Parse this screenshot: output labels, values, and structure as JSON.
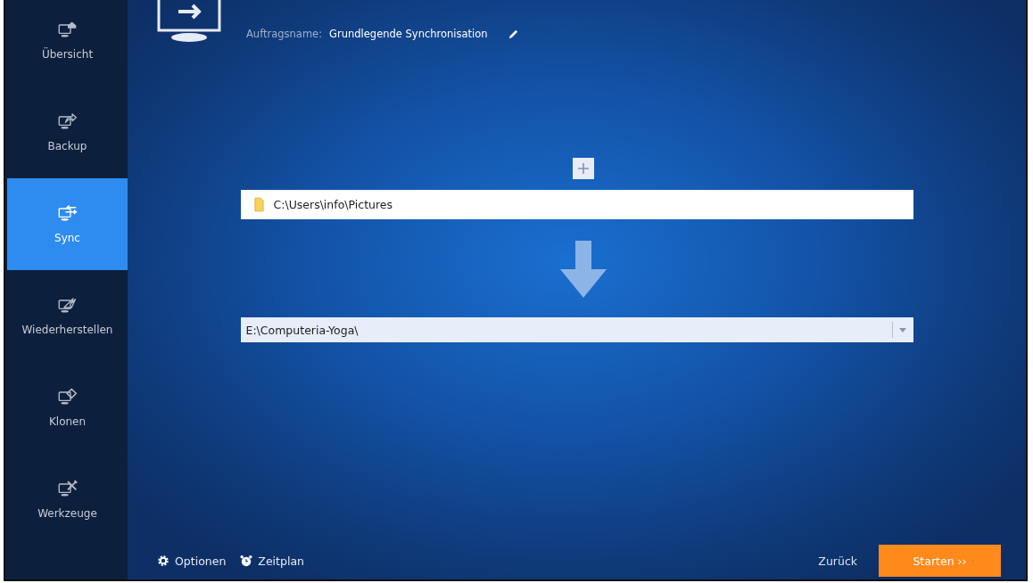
{
  "sidebar": {
    "items": [
      {
        "label": "Übersicht",
        "selected": false
      },
      {
        "label": "Backup",
        "selected": false
      },
      {
        "label": "Sync",
        "selected": true
      },
      {
        "label": "Wiederherstellen",
        "selected": false
      },
      {
        "label": "Klonen",
        "selected": false
      },
      {
        "label": "Werkzeuge",
        "selected": false
      }
    ]
  },
  "job": {
    "name_label": "Auftragsname:",
    "name": "Grundlegende Synchronisation"
  },
  "source": {
    "path": "C:\\Users\\info\\Pictures"
  },
  "destination": {
    "value": "E:\\Computeria-Yoga\\"
  },
  "footer": {
    "options": "Optionen",
    "schedule": "Zeitplan",
    "back": "Zurück",
    "start": "Starten ››"
  }
}
